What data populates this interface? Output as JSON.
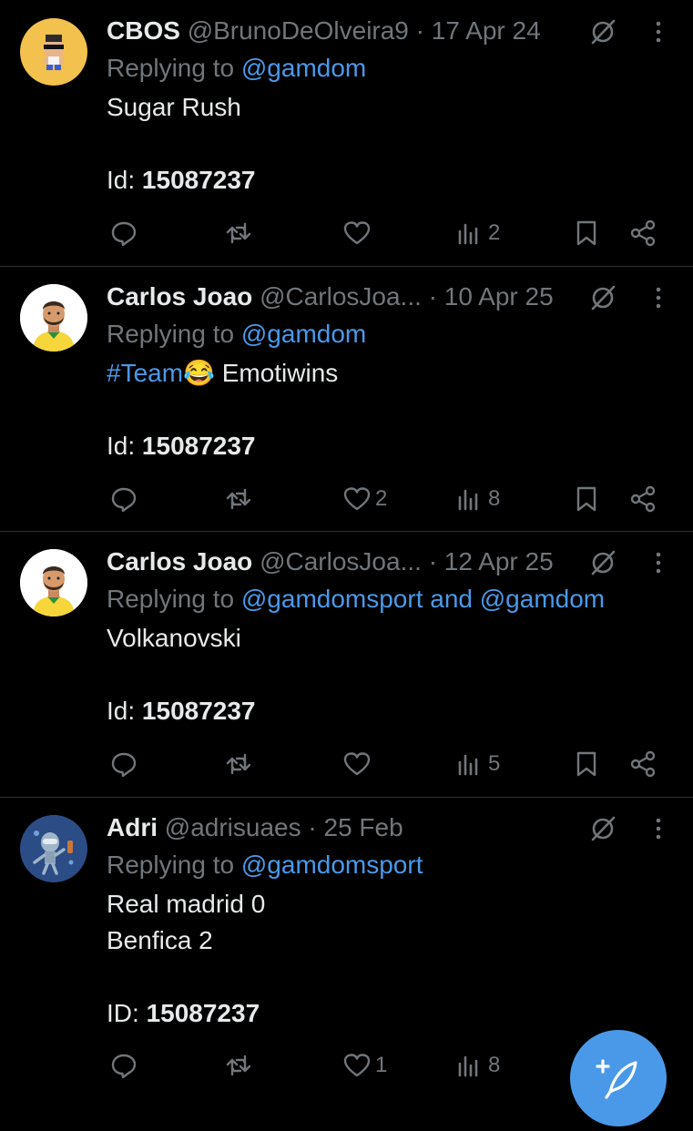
{
  "tweets": [
    {
      "name": "CBOS",
      "handle": "@BrunoDeOlveira9",
      "date": "· 17 Apr 24",
      "replying_prefix": "Replying to ",
      "replying_to": "@gamdom",
      "lines": [
        "Sugar Rush"
      ],
      "id_label": "Id: ",
      "id_value": "15087237",
      "likes": "",
      "views": "2",
      "avatar": "pixel-character-avatar"
    },
    {
      "name": "Carlos Joao",
      "handle": "@CarlosJoa...",
      "date": "· 10 Apr 25",
      "replying_prefix": "Replying to ",
      "replying_to": "@gamdom",
      "hashtag": "#Team",
      "emoji": "😂",
      "text_after": " Emotiwins",
      "id_label": "Id: ",
      "id_value": "15087237",
      "likes": "2",
      "views": "8",
      "avatar": "bearded-man-avatar"
    },
    {
      "name": "Carlos Joao",
      "handle": "@CarlosJoa...",
      "date": "· 12 Apr 25",
      "replying_prefix": "Replying to ",
      "replying_to": "@gamdomsport and @gamdom",
      "lines": [
        "Volkanovski"
      ],
      "id_label": "Id: ",
      "id_value": "15087237",
      "likes": "",
      "views": "5",
      "avatar": "bearded-man-avatar"
    },
    {
      "name": "Adri",
      "handle": "@adrisuaes",
      "date": "· 25 Feb",
      "replying_prefix": "Replying to ",
      "replying_to": "@gamdomsport",
      "lines": [
        "Real madrid 0",
        "Benfica 2"
      ],
      "id_label": "ID: ",
      "id_value": "15087237",
      "likes": "1",
      "views": "8",
      "avatar": "robot-underwater-avatar"
    }
  ],
  "icons": {
    "reply": "reply-icon",
    "repost": "repost-icon",
    "like": "heart-icon",
    "views": "views-icon",
    "bookmark": "bookmark-icon",
    "share": "share-icon",
    "grok": "grok-icon",
    "more": "more-vertical-icon",
    "compose": "compose-post-icon"
  },
  "colors": {
    "background": "#000000",
    "text": "#e7e9ea",
    "muted": "#71767b",
    "link": "#4a99e9",
    "divider": "#2f3336",
    "fab": "#4a99e9"
  }
}
